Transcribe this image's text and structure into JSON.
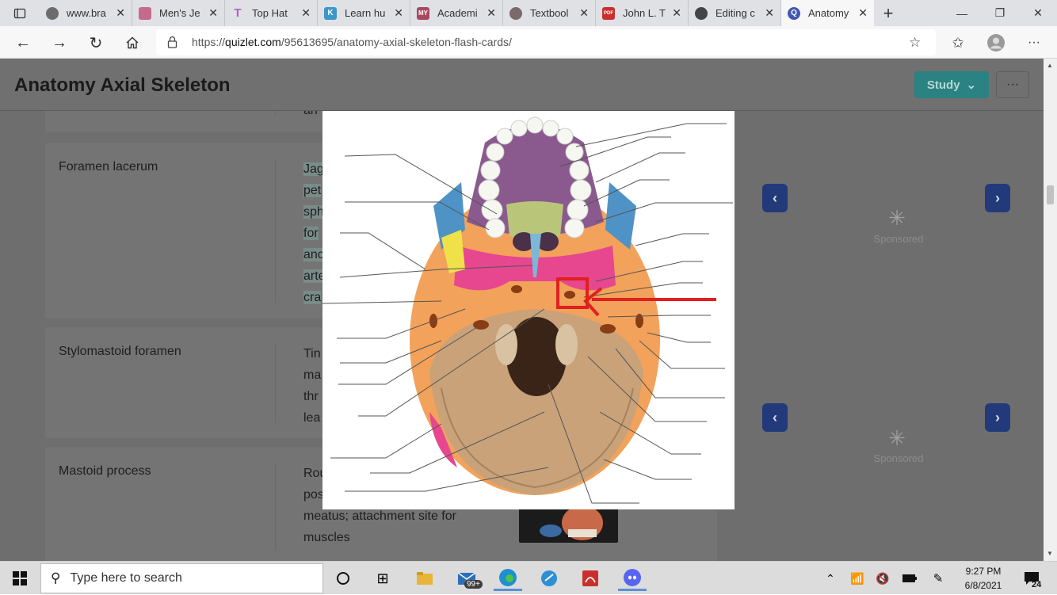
{
  "browser": {
    "tabs": [
      {
        "label": "www.bra",
        "favicon_color": "#6c6c6c"
      },
      {
        "label": "Men's Je",
        "favicon_color": "#c56a8a"
      },
      {
        "label": "Top Hat",
        "favicon_color": "#b55fc0"
      },
      {
        "label": "Learn hu",
        "favicon_color": "#3a97c9"
      },
      {
        "label": "Academi",
        "favicon_color": "#a8485f"
      },
      {
        "label": "Textbool",
        "favicon_color": "#7a6a6a"
      },
      {
        "label": "John L. T",
        "favicon_color": "#c9302c"
      },
      {
        "label": "Editing c",
        "favicon_color": "#444444"
      },
      {
        "label": "Anatomy",
        "favicon_color": "#4257b2"
      }
    ],
    "new_tab_label": "+",
    "url_prefix": "https://",
    "url_domain": "quizlet.com",
    "url_path": "/95613695/anatomy-axial-skeleton-flash-cards/"
  },
  "page": {
    "title": "Anatomy Axial Skeleton",
    "study_label": "Study",
    "more_label": "···",
    "cards": [
      {
        "term": "",
        "definition": "an"
      },
      {
        "term": "Foramen lacerum",
        "definition_lines": [
          "Jag",
          "pet",
          "sph",
          "for",
          "anc",
          "arte",
          "cra"
        ]
      },
      {
        "term": "Stylomastoid foramen",
        "definition_lines": [
          "Tin",
          "ma",
          "thr",
          "lea"
        ]
      },
      {
        "term": "Mastoid process",
        "definition_lines": [
          "Rou",
          "pos",
          "meatus; attachment site for",
          "muscles"
        ]
      }
    ],
    "ads": [
      {
        "label": "Sponsored"
      },
      {
        "label": "Sponsored"
      }
    ]
  },
  "modal": {
    "image_icon": "skull-inferior-view-diagram",
    "highlight_color": "#e02020"
  },
  "taskbar": {
    "search_placeholder": "Type here to search",
    "mail_badge": "99+",
    "time": "9:27 PM",
    "date": "6/8/2021",
    "notification_count": "24"
  }
}
